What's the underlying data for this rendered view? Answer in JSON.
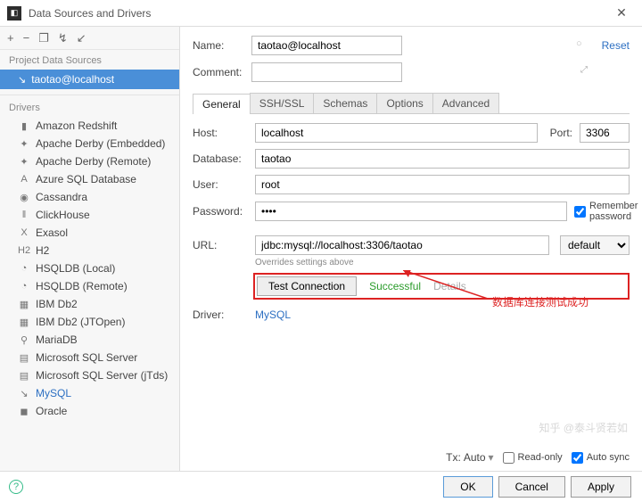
{
  "window": {
    "title": "Data Sources and Drivers"
  },
  "toolbar_icons": {
    "add": "+",
    "remove": "−",
    "copy": "❐",
    "tool": "↯",
    "refresh": "↙"
  },
  "sidebar": {
    "project_head": "Project Data Sources",
    "source": {
      "name": "taotao@localhost"
    },
    "drivers_head": "Drivers",
    "drivers": [
      {
        "label": "Amazon Redshift",
        "icon": "▮"
      },
      {
        "label": "Apache Derby (Embedded)",
        "icon": "✦"
      },
      {
        "label": "Apache Derby (Remote)",
        "icon": "✦"
      },
      {
        "label": "Azure SQL Database",
        "icon": "A"
      },
      {
        "label": "Cassandra",
        "icon": "◉"
      },
      {
        "label": "ClickHouse",
        "icon": "‖"
      },
      {
        "label": "Exasol",
        "icon": "X"
      },
      {
        "label": "H2",
        "icon": "H2"
      },
      {
        "label": "HSQLDB (Local)",
        "icon": "◔"
      },
      {
        "label": "HSQLDB (Remote)",
        "icon": "◔"
      },
      {
        "label": "IBM Db2",
        "icon": "▦"
      },
      {
        "label": "IBM Db2 (JTOpen)",
        "icon": "▦"
      },
      {
        "label": "MariaDB",
        "icon": "⚲"
      },
      {
        "label": "Microsoft SQL Server",
        "icon": "▤"
      },
      {
        "label": "Microsoft SQL Server (jTds)",
        "icon": "▤"
      },
      {
        "label": "MySQL",
        "icon": "↘",
        "selected": true
      },
      {
        "label": "Oracle",
        "icon": "◼"
      }
    ]
  },
  "form": {
    "name_label": "Name:",
    "name_value": "taotao@localhost",
    "comment_label": "Comment:",
    "comment_value": "",
    "reset": "Reset",
    "tabs": [
      "General",
      "SSH/SSL",
      "Schemas",
      "Options",
      "Advanced"
    ],
    "host_label": "Host:",
    "host_value": "localhost",
    "port_label": "Port:",
    "port_value": "3306",
    "db_label": "Database:",
    "db_value": "taotao",
    "user_label": "User:",
    "user_value": "root",
    "pw_label": "Password:",
    "pw_value": "••••",
    "remember": "Remember password",
    "url_label": "URL:",
    "url_value": "jdbc:mysql://localhost:3306/taotao",
    "url_mode": "default",
    "override": "Overrides settings above",
    "test_btn": "Test Connection",
    "test_result": "Successful",
    "test_details": "Details",
    "driver_label": "Driver:",
    "driver_value": "MySQL",
    "annotation": "数据库连接测试成功",
    "tx_label": "Tx:",
    "tx_value": "Auto",
    "readonly": "Read-only",
    "autosync": "Auto sync"
  },
  "footer": {
    "ok": "OK",
    "cancel": "Cancel",
    "apply": "Apply"
  },
  "watermark": "知乎 @泰斗贤若如"
}
